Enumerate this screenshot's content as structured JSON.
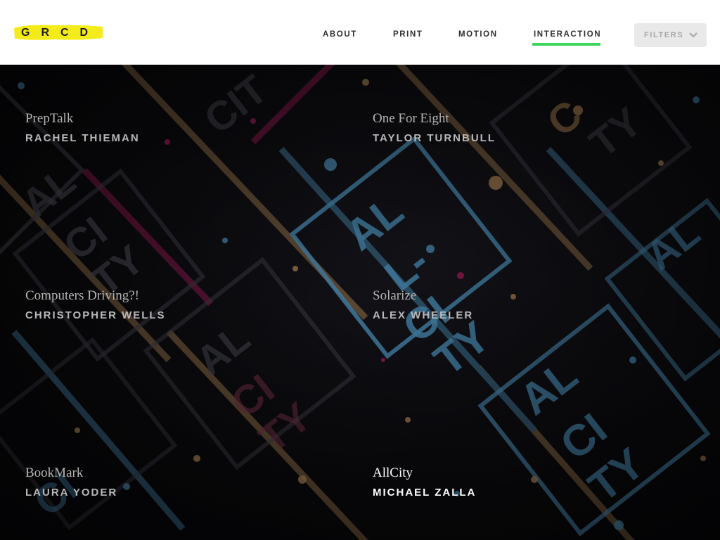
{
  "logo": {
    "text": "GRCD",
    "highlight_color": "#f4ec1a"
  },
  "nav": {
    "items": [
      {
        "label": "ABOUT"
      },
      {
        "label": "PRINT"
      },
      {
        "label": "MOTION"
      },
      {
        "label": "INTERACTION",
        "active": true
      }
    ],
    "active_color": "#3dd65b",
    "filters": {
      "label": "FILTERS",
      "icon": "chevron-down-icon"
    }
  },
  "background": {
    "artwork_text": "ALL CITY",
    "colors": [
      "#58a6d6",
      "#c89a62",
      "#c2206b",
      "#0c0c0f"
    ]
  },
  "projects": [
    {
      "title": "PrepTalk",
      "author": "RACHEL THIEMAN"
    },
    {
      "title": "One For Eight",
      "author": "TAYLOR TURNBULL"
    },
    {
      "title": "Computers Driving?!",
      "author": "CHRISTOPHER WELLS"
    },
    {
      "title": "Solarize",
      "author": "ALEX WHEELER"
    },
    {
      "title": "BookMark",
      "author": "LAURA YODER"
    },
    {
      "title": "AllCity",
      "author": "MICHAEL ZALLA",
      "active": true
    }
  ]
}
